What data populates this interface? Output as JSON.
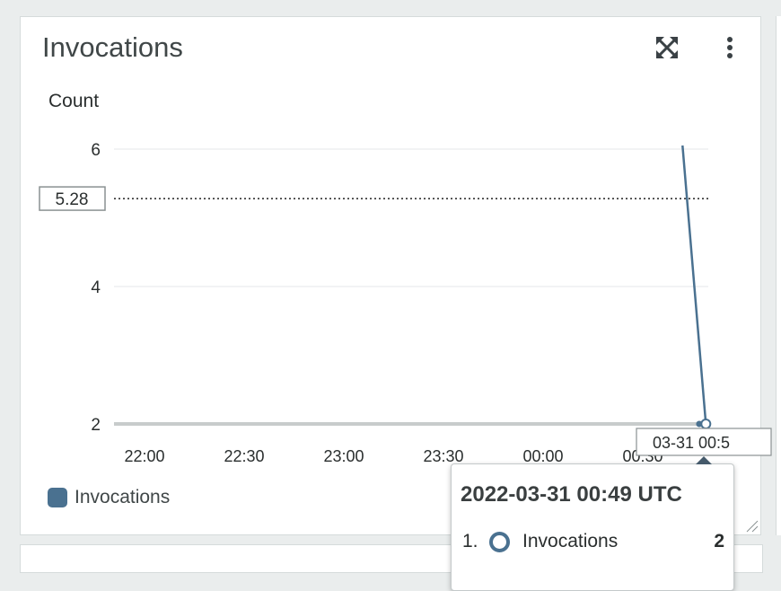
{
  "widget": {
    "title": "Invocations",
    "unit_label": "Count",
    "expand_icon": "expand-arrows-icon",
    "menu_icon": "vertical-ellipsis-icon"
  },
  "chart_data": {
    "type": "line",
    "ylabel": "Count",
    "ylim": [
      1.8,
      6
    ],
    "yticks": [
      "6",
      "4",
      "2"
    ],
    "xticks": [
      "22:00",
      "22:30",
      "23:00",
      "23:30",
      "00:00",
      "00:30"
    ],
    "threshold": {
      "value": 5.28,
      "label": "5.28"
    },
    "series": [
      {
        "name": "Invocations",
        "color": "#4a7190",
        "points": [
          {
            "x": "21:55",
            "y": 2
          },
          {
            "x": "00:47",
            "y": 2
          },
          {
            "x": "00:49",
            "y": 2
          }
        ]
      }
    ],
    "legend": [
      "Invocations"
    ],
    "hover_axis_label": "03-31 00:5"
  },
  "tooltip": {
    "title": "2022-03-31 00:49 UTC",
    "rows": [
      {
        "index": "1.",
        "name": "Invocations",
        "value": "2"
      }
    ]
  }
}
